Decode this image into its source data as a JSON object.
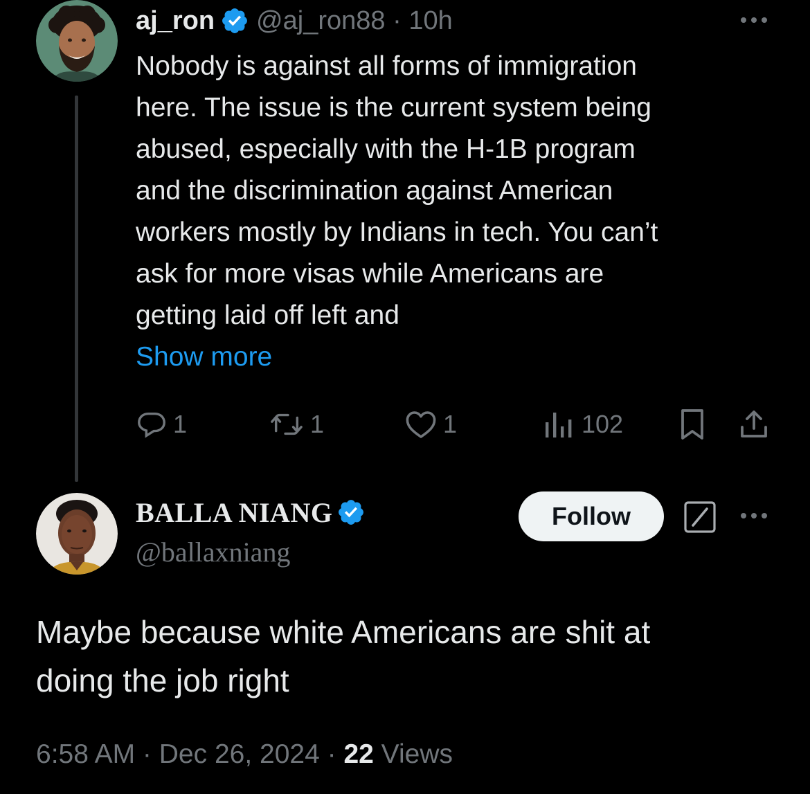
{
  "colors": {
    "background": "#000000",
    "primary_text": "#e7e9ea",
    "secondary_text": "#71767b",
    "link": "#1d9bf0",
    "verified_badge": "#1d9bf0",
    "thread_line": "#333639",
    "follow_button_bg": "#eff3f4"
  },
  "parent_tweet": {
    "display_name": "aj_ron",
    "handle": "@aj_ron88",
    "separator": " · ",
    "time": "10h",
    "avatar_icon": "user-avatar-photo",
    "body_lines": [
      "Nobody is against all forms of immigration",
      "here. The issue is the current system being",
      "abused, especially with the H-1B program",
      "and the discrimination against American",
      "workers mostly by Indians in tech. You can’t",
      "ask for more visas while Americans are",
      "getting laid off left and"
    ],
    "show_more_label": "Show more",
    "actions": {
      "replies": "1",
      "reposts": "1",
      "likes": "1",
      "views": "102"
    }
  },
  "reply_tweet": {
    "display_name": "BALLA NIANG",
    "handle": "@ballaxniang",
    "avatar_icon": "user-avatar-photo",
    "follow_label": "Follow",
    "body_lines": [
      "Maybe because white Americans are shit at",
      "doing the job right"
    ],
    "time": "6:58 AM",
    "date": "Dec 26, 2024",
    "separator": " · ",
    "views_count": "22",
    "views_label": " Views"
  }
}
